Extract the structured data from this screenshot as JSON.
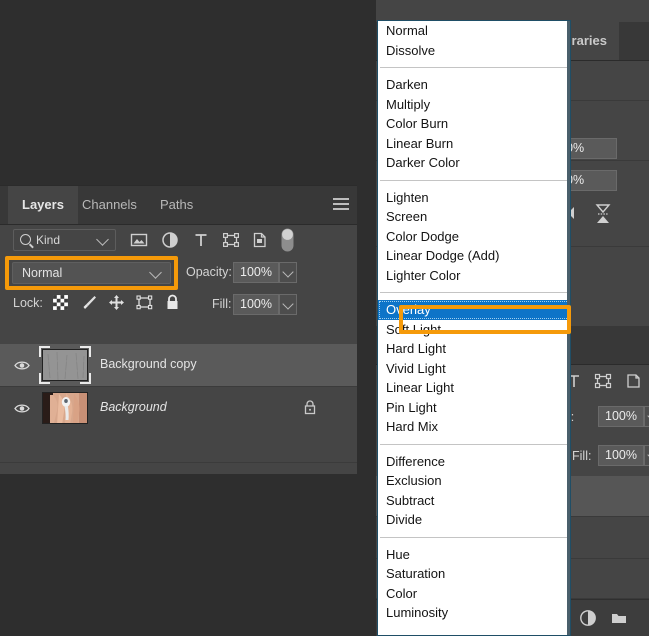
{
  "app": {
    "theme_bg": "#2e2e2e",
    "panel_bg": "#454545",
    "accent_orange": "#f59a0a",
    "selection_blue": "#0d74c8"
  },
  "layers_panel": {
    "tabs": [
      {
        "label": "Layers",
        "active": true
      },
      {
        "label": "Channels",
        "active": false
      },
      {
        "label": "Paths",
        "active": false
      }
    ],
    "menu_icon": "hamburger-menu-icon",
    "filter": {
      "search_icon": "magnifier-icon",
      "kind_label": "Kind",
      "caret_icon": "chevron-down-icon",
      "type_filters": [
        "image-filter-icon",
        "adjustment-filter-icon",
        "type-filter-icon",
        "shape-filter-icon",
        "smart-object-filter-icon"
      ],
      "toggle_icon": "filter-toggle-switch"
    },
    "blend": {
      "mode_value": "Normal",
      "caret_icon": "chevron-down-icon",
      "highlighted": true,
      "opacity_label": "Opacity:",
      "opacity_value": "100%",
      "opacity_caret_icon": "chevron-down-icon"
    },
    "lock": {
      "label": "Lock:",
      "icons": [
        "lock-transparent-pixels-icon",
        "lock-image-pixels-icon",
        "lock-position-icon",
        "lock-artboard-nesting-icon",
        "lock-all-icon"
      ],
      "fill_label": "Fill:",
      "fill_value": "100%",
      "fill_caret_icon": "chevron-down-icon"
    },
    "layers": [
      {
        "name": "Background copy",
        "visible": true,
        "selected": true,
        "italic": false,
        "locked": false,
        "thumbnail": "gray-texture-thumbnail"
      },
      {
        "name": "Background",
        "visible": true,
        "selected": false,
        "italic": true,
        "locked": true,
        "thumbnail": "hand-holding-earbud-thumbnail"
      }
    ]
  },
  "right_panel": {
    "tab_label": "ibraries",
    "field_1_value": "0%",
    "field_2_value": "0%",
    "collapse_icon": "collapse-arrow-icon",
    "hourglass_icon": "hourglass-icon"
  },
  "right_panel_lower": {
    "icons": [
      "type-filter-icon",
      "shape-filter-icon",
      "smart-object-filter-icon"
    ],
    "opacity_label": "city:",
    "opacity_value": "100%",
    "fill_label": "Fill:",
    "fill_value": "100%",
    "bottom_icons": [
      "adjustment-layer-icon",
      "new-group-folder-icon"
    ]
  },
  "blend_dropdown": {
    "selected": "Overlay",
    "highlighted": true,
    "groups": [
      {
        "items": [
          "Normal",
          "Dissolve"
        ]
      },
      {
        "items": [
          "Darken",
          "Multiply",
          "Color Burn",
          "Linear Burn",
          "Darker Color"
        ]
      },
      {
        "items": [
          "Lighten",
          "Screen",
          "Color Dodge",
          "Linear Dodge (Add)",
          "Lighter Color"
        ]
      },
      {
        "items": [
          "Overlay",
          "Soft Light",
          "Hard Light",
          "Vivid Light",
          "Linear Light",
          "Pin Light",
          "Hard Mix"
        ]
      },
      {
        "items": [
          "Difference",
          "Exclusion",
          "Subtract",
          "Divide"
        ]
      },
      {
        "items": [
          "Hue",
          "Saturation",
          "Color",
          "Luminosity"
        ]
      }
    ]
  }
}
